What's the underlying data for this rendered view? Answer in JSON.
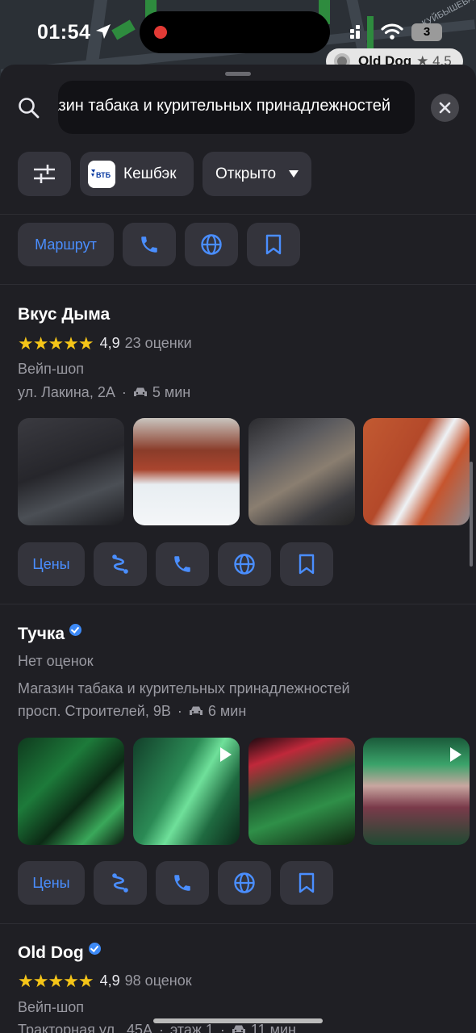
{
  "status": {
    "time": "01:54",
    "battery": "3"
  },
  "map": {
    "pin_label": "Old Dog",
    "pin_rating": "★ 4.5",
    "street_label": "КУЙБЫШЕВА"
  },
  "search": {
    "value": "Магазин табака и курительных принадлежностей"
  },
  "filters": {
    "cashback_label": "Кешбэк",
    "cashback_brand": "ВТБ",
    "open_label": "Открыто"
  },
  "top_actions": {
    "route_label": "Маршрут"
  },
  "places": [
    {
      "name": "Вкус Дыма",
      "verified": false,
      "stars": "★★★★★",
      "rating": "4,9",
      "reviews": "23 оценки",
      "category": "Вейп-шоп",
      "address": "ул. Лакина, 2А",
      "travel": "5 мин",
      "prices_label": "Цены"
    },
    {
      "name": "Тучка",
      "verified": true,
      "no_rating": "Нет оценок",
      "category": "Магазин табака и курительных принадлежностей",
      "address": "просп. Строителей, 9В",
      "travel": "6 мин",
      "prices_label": "Цены"
    },
    {
      "name": "Old Dog",
      "verified": true,
      "stars": "★★★★★",
      "rating": "4,9",
      "reviews": "98 оценок",
      "category": "Вейп-шоп",
      "address": "Тракторная ул., 45А",
      "floor": "этаж 1",
      "travel": "11 мин"
    }
  ],
  "colors": {
    "accent": "#4a8eff",
    "star": "#f5c518",
    "chip_bg": "#34343c",
    "sheet_bg": "#1f1f24"
  },
  "icons": [
    "search-icon",
    "close-icon",
    "filter-icon",
    "phone-icon",
    "globe-icon",
    "bookmark-icon",
    "route-icon",
    "car-icon",
    "location-arrow-icon",
    "wifi-icon",
    "signal-icon",
    "verified-icon",
    "play-icon"
  ]
}
